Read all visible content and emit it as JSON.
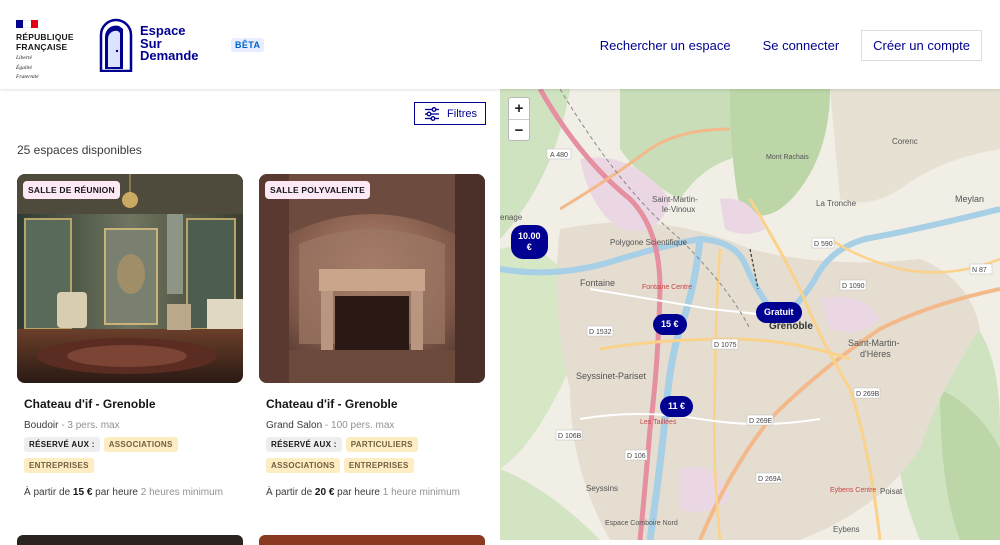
{
  "header": {
    "rf_name_1": "RÉPUBLIQUE",
    "rf_name_2": "FRANÇAISE",
    "rf_motto_1": "Liberté",
    "rf_motto_2": "Égalité",
    "rf_motto_3": "Fraternité",
    "brand_1": "Espace",
    "brand_2": "Sur",
    "brand_3": "Demande",
    "beta": "BÊTA",
    "nav": {
      "search": "Rechercher un espace",
      "login": "Se connecter",
      "signup": "Créer un compte"
    },
    "colors": {
      "flag_blue": "#000091",
      "flag_white": "#ffffff",
      "flag_red": "#e1000f",
      "accent": "#000091"
    }
  },
  "list": {
    "filters_label": "Filtres",
    "count_text": "25 espaces disponibles",
    "cards": [
      {
        "category": "SALLE DE RÉUNION",
        "title": "Chateau d'if - Grenoble",
        "room": "Boudoir",
        "capacity": " - 3 pers. max",
        "reserved_label": "RÉSERVÉ AUX :",
        "audiences": [
          "ASSOCIATIONS",
          "ENTREPRISES"
        ],
        "price_prefix": "À partir de ",
        "price_value": "15 €",
        "price_unit": " par heure ",
        "price_min": "2 heures minimum"
      },
      {
        "category": "SALLE POLYVALENTE",
        "title": "Chateau d'if - Grenoble",
        "room": "Grand Salon",
        "capacity": " - 100 pers. max",
        "reserved_label": "RÉSERVÉ AUX :",
        "audiences": [
          "PARTICULIERS",
          "ASSOCIATIONS",
          "ENTREPRISES"
        ],
        "price_prefix": "À partir de ",
        "price_value": "20 €",
        "price_unit": " par heure ",
        "price_min": "1 heure minimum"
      }
    ]
  },
  "map": {
    "zoom_in": "+",
    "zoom_out": "−",
    "markers": [
      {
        "label_1": "10.00",
        "label_2": "€"
      },
      {
        "label_1": "15 €"
      },
      {
        "label_1": "Gratuit"
      },
      {
        "label_1": "11 €"
      }
    ],
    "places": {
      "grenoble": "Grenoble",
      "fontaine": "Fontaine",
      "seyssinet": "Seyssinet-Pariset",
      "st_martin_dheres_1": "Saint-Martin-",
      "st_martin_dheres_2": "d'Hères",
      "st_martin_vinoux_1": "Saint-Martin-",
      "st_martin_vinoux_2": "le-Vinoux",
      "meylan": "Meylan",
      "la_tronche": "La Tronche",
      "polygone": "Polygone Scientifique",
      "seyssins": "Seyssins",
      "poisat": "Poisat",
      "eybens": "Eybens",
      "corenc": "Corenc",
      "mont_rachais": "Mont Rachais",
      "enage": "enage",
      "a480": "A 480",
      "d1532": "D 1532",
      "d1075": "D 1075",
      "d590": "D 590",
      "d1090": "D 1090",
      "n87": "N 87",
      "d269b": "D 269B",
      "d269e": "D 269E",
      "d269a": "D 269A",
      "d106b": "D 106B",
      "d106": "D 106",
      "fontaine_centre": "Fontaine Centre",
      "les_taillees": "Les Taillées",
      "eybens_centre": "Eybens Centre",
      "espace_comboire": "Espace Comboire Nord"
    }
  }
}
